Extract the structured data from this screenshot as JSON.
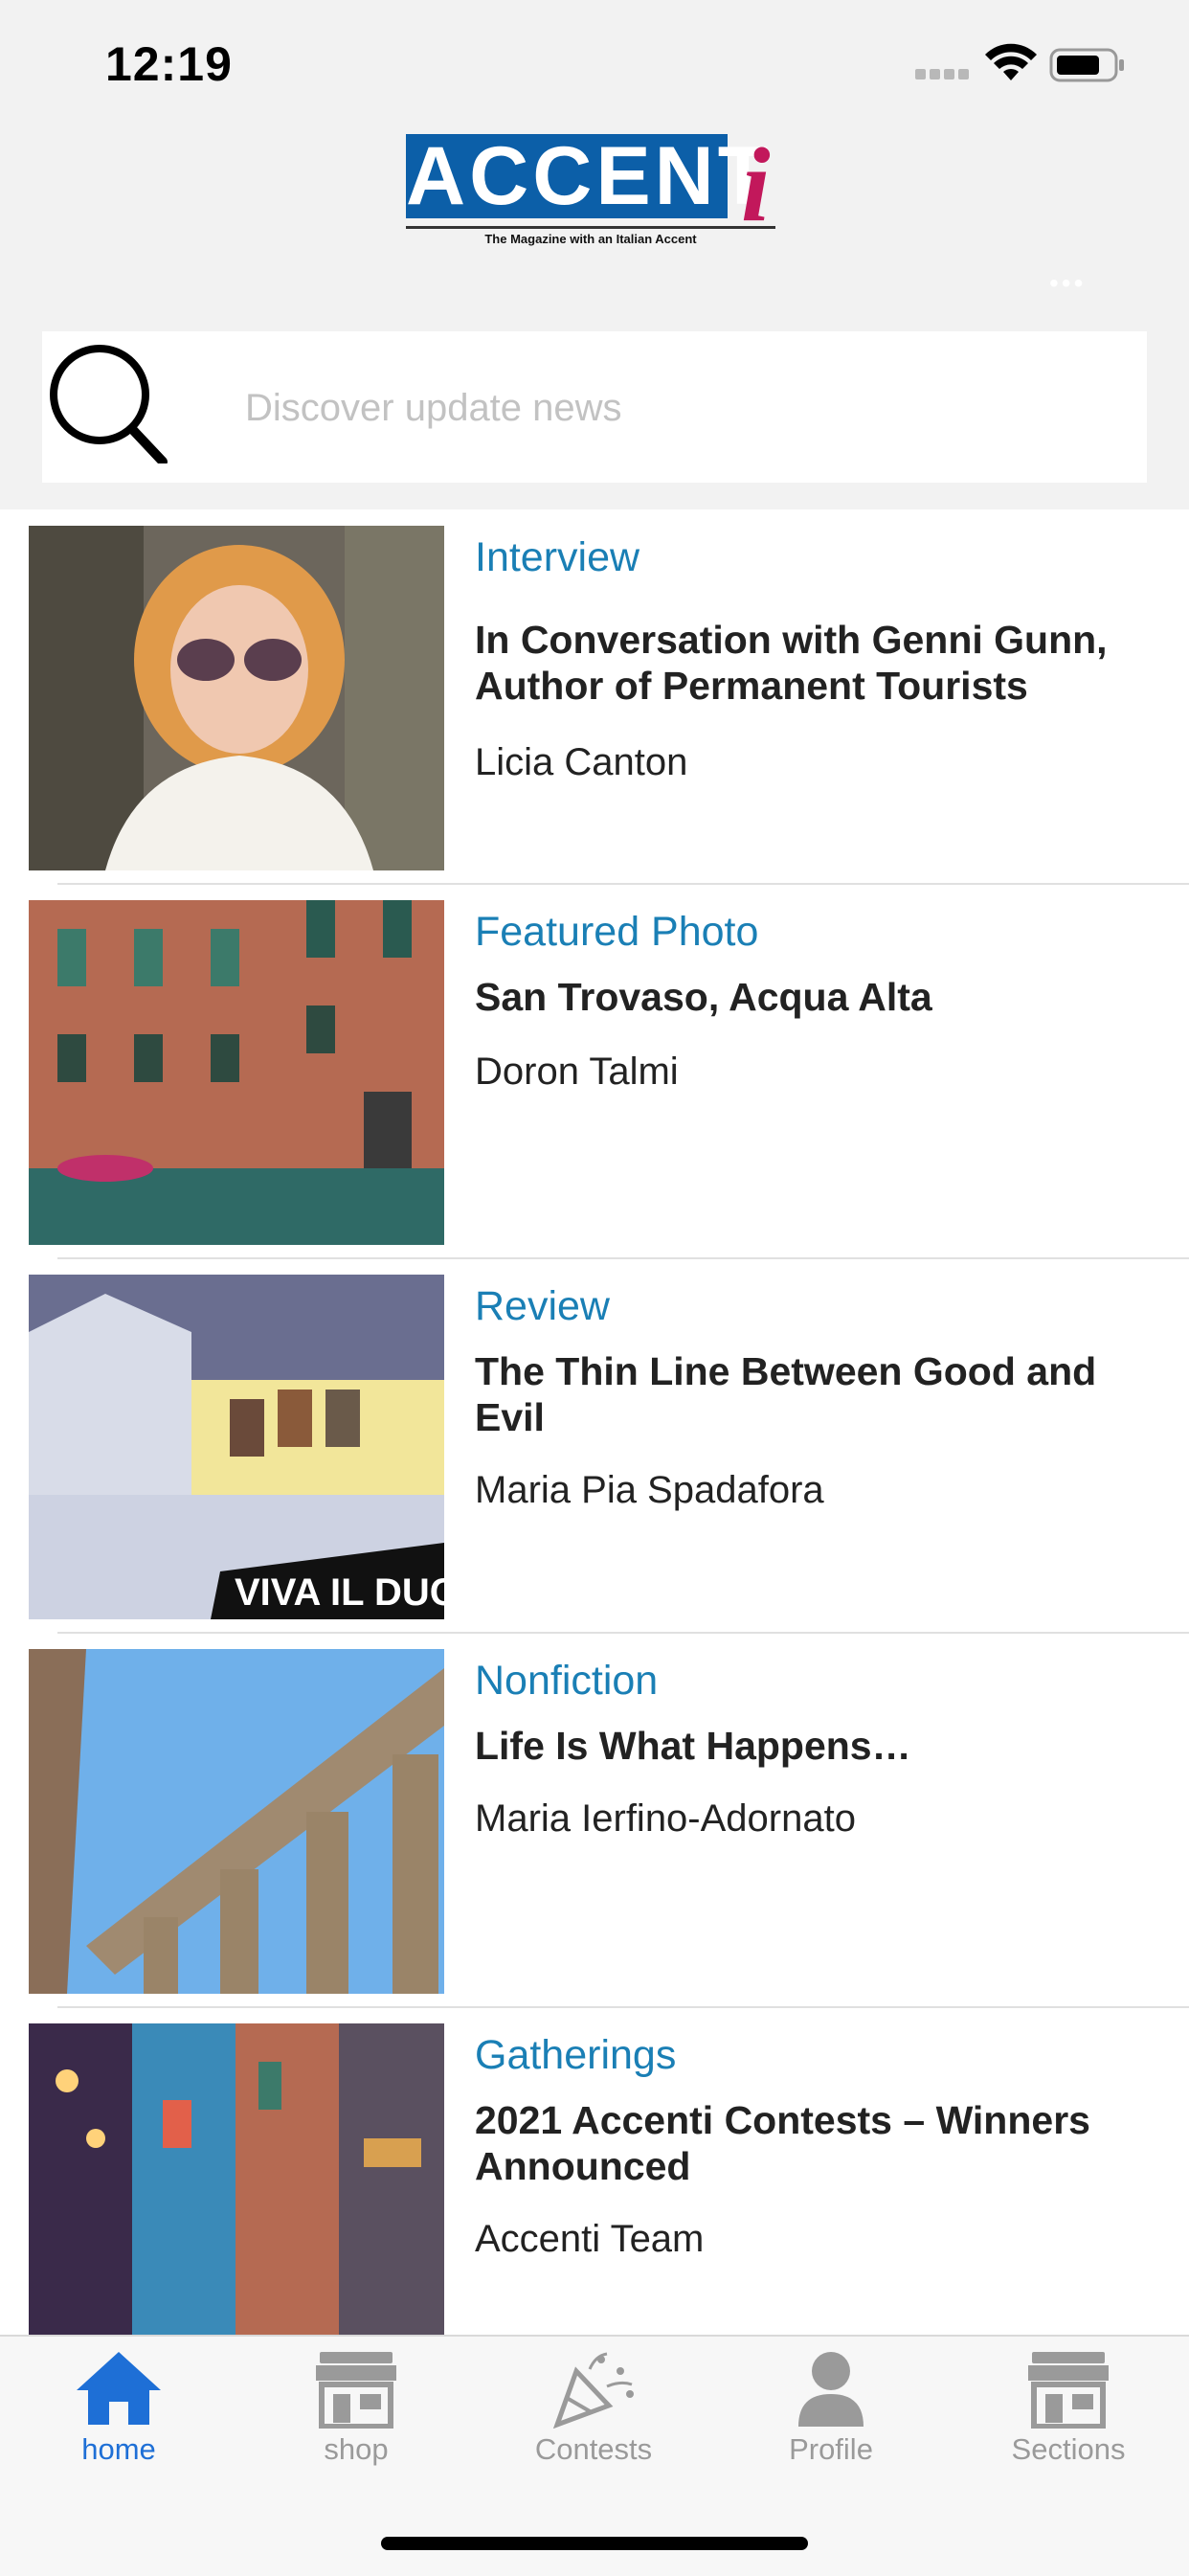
{
  "status_bar": {
    "time": "12:19"
  },
  "logo": {
    "main": "ACCENT",
    "accent_letter": "i",
    "tagline": "The Magazine with an Italian Accent"
  },
  "search": {
    "placeholder": "Discover update news"
  },
  "articles": [
    {
      "category": "Interview",
      "title": "In Conversation with Genni Gunn, Author of Permanent Tourists",
      "author": "Licia Canton"
    },
    {
      "category": "Featured Photo",
      "title": "San Trovaso, Acqua Alta",
      "author": "Doron Talmi"
    },
    {
      "category": "Review",
      "title": "The Thin Line Between Good and Evil",
      "author": "Maria Pia Spadafora"
    },
    {
      "category": "Nonfiction",
      "title": "Life Is What Happens…",
      "author": "Maria Ierfino-Adornato"
    },
    {
      "category": "Gatherings",
      "title": "2021 Accenti Contests – Winners Announced",
      "author": "Accenti Team"
    }
  ],
  "tabs": [
    {
      "label": "home",
      "icon": "home-icon",
      "active": true
    },
    {
      "label": "shop",
      "icon": "store-icon"
    },
    {
      "label": "Contests",
      "icon": "party-popper-icon"
    },
    {
      "label": "Profile",
      "icon": "person-icon"
    },
    {
      "label": "Sections",
      "icon": "store-icon"
    }
  ],
  "colors": {
    "accent_blue": "#1a7fb5",
    "logo_blue": "#0c5fa8",
    "logo_magenta": "#c2185b",
    "tab_active": "#1e6fd6",
    "tab_inactive": "#9a9a9a"
  }
}
